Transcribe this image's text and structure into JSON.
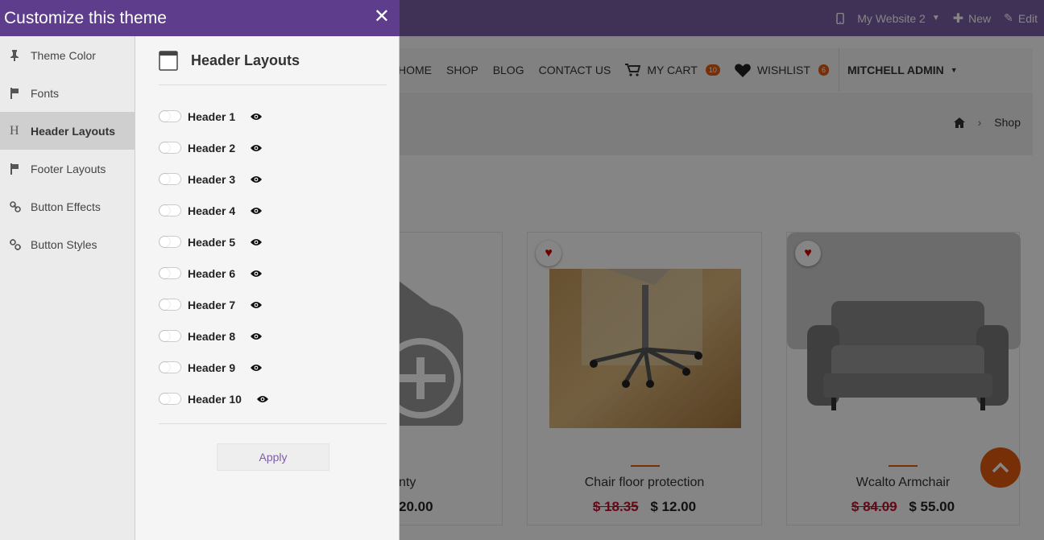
{
  "topbar": {
    "website": "My Website 2",
    "new_label": "New",
    "edit_label": "Edit"
  },
  "site": {
    "nav": [
      "HOME",
      "SHOP",
      "BLOG",
      "CONTACT US"
    ],
    "cart_label": "MY CART",
    "cart_count": "10",
    "wishlist_label": "WISHLIST",
    "wishlist_count": "6",
    "user": "MITCHELL ADMIN",
    "breadcrumb_current": "Shop"
  },
  "products": [
    {
      "name": "nty",
      "old_price": "",
      "price": "20.00"
    },
    {
      "name": "Chair floor protection",
      "old_price": "$ 18.35",
      "price": "$ 12.00"
    },
    {
      "name": "Wcalto Armchair",
      "old_price": "$ 84.09",
      "price": "$ 55.00"
    }
  ],
  "panel": {
    "title": "Customize this theme",
    "sidebar": [
      {
        "label": "Theme Color",
        "icon": "pin-icon"
      },
      {
        "label": "Fonts",
        "icon": "flag-icon"
      },
      {
        "label": "Header Layouts",
        "icon": "heading-icon"
      },
      {
        "label": "Footer Layouts",
        "icon": "flag-icon"
      },
      {
        "label": "Button Effects",
        "icon": "link-icon"
      },
      {
        "label": "Button Styles",
        "icon": "unlink-icon"
      }
    ],
    "active_section": "Header Layouts",
    "section_title": "Header Layouts",
    "headers": [
      "Header 1",
      "Header 2",
      "Header 3",
      "Header 4",
      "Header 5",
      "Header 6",
      "Header 7",
      "Header 8",
      "Header 9",
      "Header 10"
    ],
    "apply_label": "Apply"
  },
  "colors": {
    "topbar": "#7c5ea8",
    "panel_header": "#5d3d8c",
    "accent": "#e25b0f",
    "price_old": "#c0102e"
  }
}
